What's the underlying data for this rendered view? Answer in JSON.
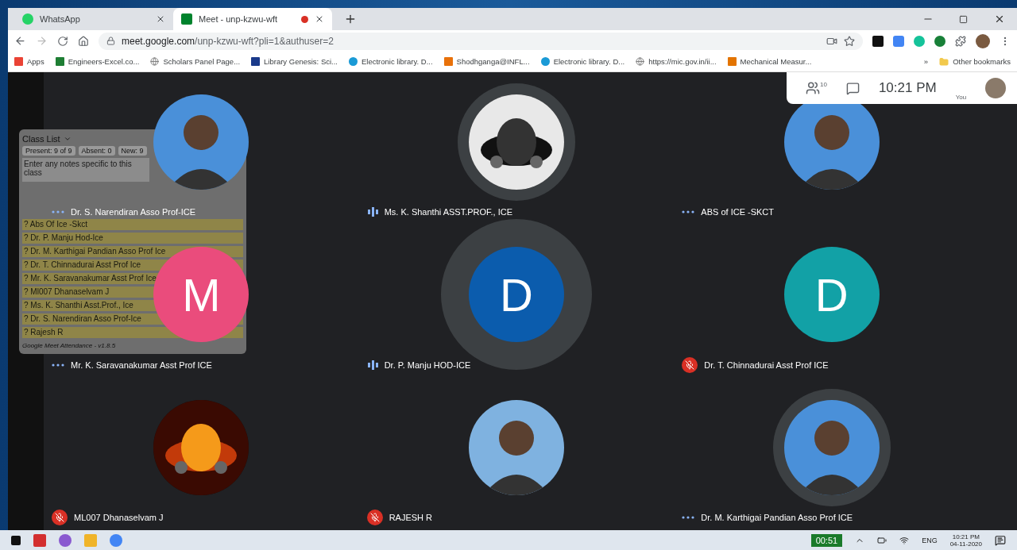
{
  "tabs": [
    {
      "title": "WhatsApp",
      "selected": false,
      "recording": false
    },
    {
      "title": "Meet - unp-kzwu-wft",
      "selected": true,
      "recording": true
    }
  ],
  "address": {
    "host": "meet.google.com",
    "path": "/unp-kzwu-wft?pli=1&authuser=2"
  },
  "bookmarks": [
    "Apps",
    "Engineers-Excel.co...",
    "Scholars Panel Page...",
    "Library Genesis: Sci...",
    "Electronic library. D...",
    "Shodhganga@INFL...",
    "Electronic library. D...",
    "https://mic.gov.in/ii...",
    "Mechanical Measur..."
  ],
  "bookmarks_more": "»",
  "other_bookmarks": "Other bookmarks",
  "meeting_bar": {
    "participants": "10",
    "time": "10:21 PM",
    "self_label": "You"
  },
  "class_list": {
    "title": "Class List",
    "chips": [
      "Present: 9 of 9",
      "Absent: 0",
      "New: 9"
    ],
    "notes_placeholder": "Enter any notes specific to this class",
    "entries": [
      "? Abs Of Ice -Skct",
      "? Dr. P. Manju Hod-Ice",
      "? Dr. M. Karthigai Pandian Asso Prof Ice",
      "? Dr. T. Chinnadurai Asst Prof Ice",
      "? Mr. K. Saravanakumar Asst Prof Ice",
      "? Ml007 Dhanaselvam J",
      "? Ms. K. Shanthi Asst.Prof., Ice",
      "? Dr. S. Narendiran Asso Prof-Ice",
      "? Rajesh R"
    ],
    "footer": "Google Meet Attendance - v1.8.5"
  },
  "participants": [
    {
      "name": "Dr. S. Narendiran Asso Prof-ICE",
      "speaking": false,
      "muted": false,
      "highlighted": false
    },
    {
      "name": "Ms. K. Shanthi ASST.PROF., ICE",
      "kind": "picture",
      "speaking": true,
      "muted": false,
      "highlighted": true
    },
    {
      "name": "ABS of ICE -SKCT",
      "speaking": false,
      "muted": false,
      "highlighted": false
    },
    {
      "name": "Mr. K. Saravanakumar Asst Prof ICE",
      "kind": "letter",
      "letter": "M",
      "color": "#ea4c7c",
      "speaking": false,
      "muted": false,
      "highlighted": false
    },
    {
      "name": "Dr. P. Manju HOD-ICE",
      "kind": "letter",
      "letter": "D",
      "color": "#0b5cad",
      "speaking": true,
      "muted": false,
      "highlighted": true
    },
    {
      "name": "Dr. T. Chinnadurai Asst Prof ICE",
      "kind": "letter",
      "letter": "D",
      "color": "#12a1a6",
      "speaking": false,
      "muted": true,
      "highlighted": false
    },
    {
      "name": "ML007 Dhanaselvam J",
      "kind": "picture",
      "speaking": false,
      "muted": true,
      "highlighted": false
    },
    {
      "name": "RAJESH R",
      "speaking": false,
      "muted": true,
      "highlighted": false
    },
    {
      "name": "Dr. M. Karthigai Pandian Asso Prof ICE",
      "speaking": false,
      "muted": false,
      "highlighted": true
    }
  ],
  "taskbar": {
    "timer": "00:51",
    "language": "ENG",
    "time": "10:21 PM",
    "date": "04-11-2020"
  }
}
